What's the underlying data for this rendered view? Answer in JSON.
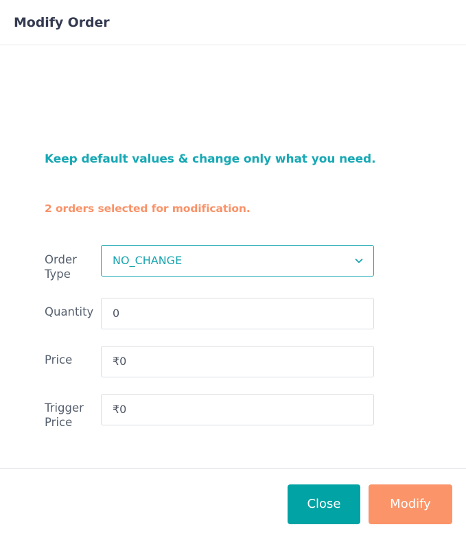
{
  "dialog": {
    "title": "Modify Order",
    "notice_primary": "Keep default values & change only what you need.",
    "notice_secondary": "2 orders selected for modification."
  },
  "form": {
    "order_type": {
      "label": "Order Type",
      "value": "NO_CHANGE",
      "icon": "chevron-down-icon"
    },
    "quantity": {
      "label": "Quantity",
      "value": "0"
    },
    "price": {
      "label": "Price",
      "value": "₹0"
    },
    "trigger_price": {
      "label": "Trigger Price",
      "value": "₹0"
    }
  },
  "footer": {
    "close_label": "Close",
    "modify_label": "Modify"
  },
  "colors": {
    "teal": "#17a8b4",
    "teal_button": "#01a3a4",
    "orange": "#f99268",
    "orange_button": "#fb9468",
    "title": "#343a50",
    "label": "#56606e",
    "border": "#d9dde2",
    "divider": "#e4e6ea"
  }
}
